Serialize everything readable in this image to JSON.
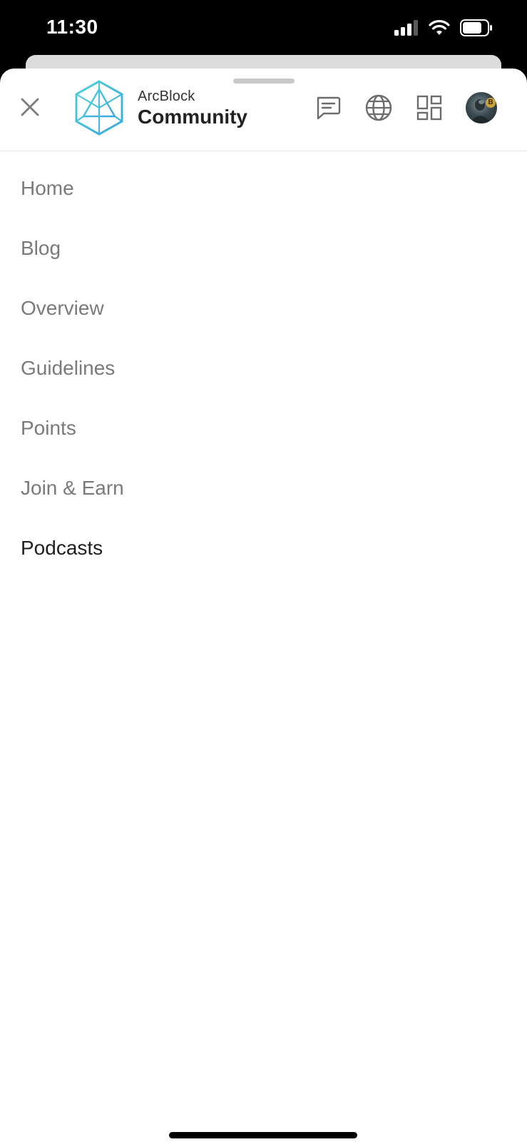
{
  "status_bar": {
    "time": "11:30"
  },
  "header": {
    "brand_top": "ArcBlock",
    "brand_bottom": "Community",
    "icons": [
      "close-icon",
      "chat-icon",
      "globe-icon",
      "apps-grid-icon",
      "avatar"
    ]
  },
  "menu": {
    "items": [
      {
        "label": "Home"
      },
      {
        "label": "Blog"
      },
      {
        "label": "Overview"
      },
      {
        "label": "Guidelines"
      },
      {
        "label": "Points"
      },
      {
        "label": "Join & Earn"
      },
      {
        "label": "Podcasts"
      }
    ],
    "active": "Podcasts"
  },
  "colors": {
    "logo_accent": "#3cc4d9",
    "menu_text": "#7a7a7a",
    "menu_active_text": "#1f1f1f"
  }
}
